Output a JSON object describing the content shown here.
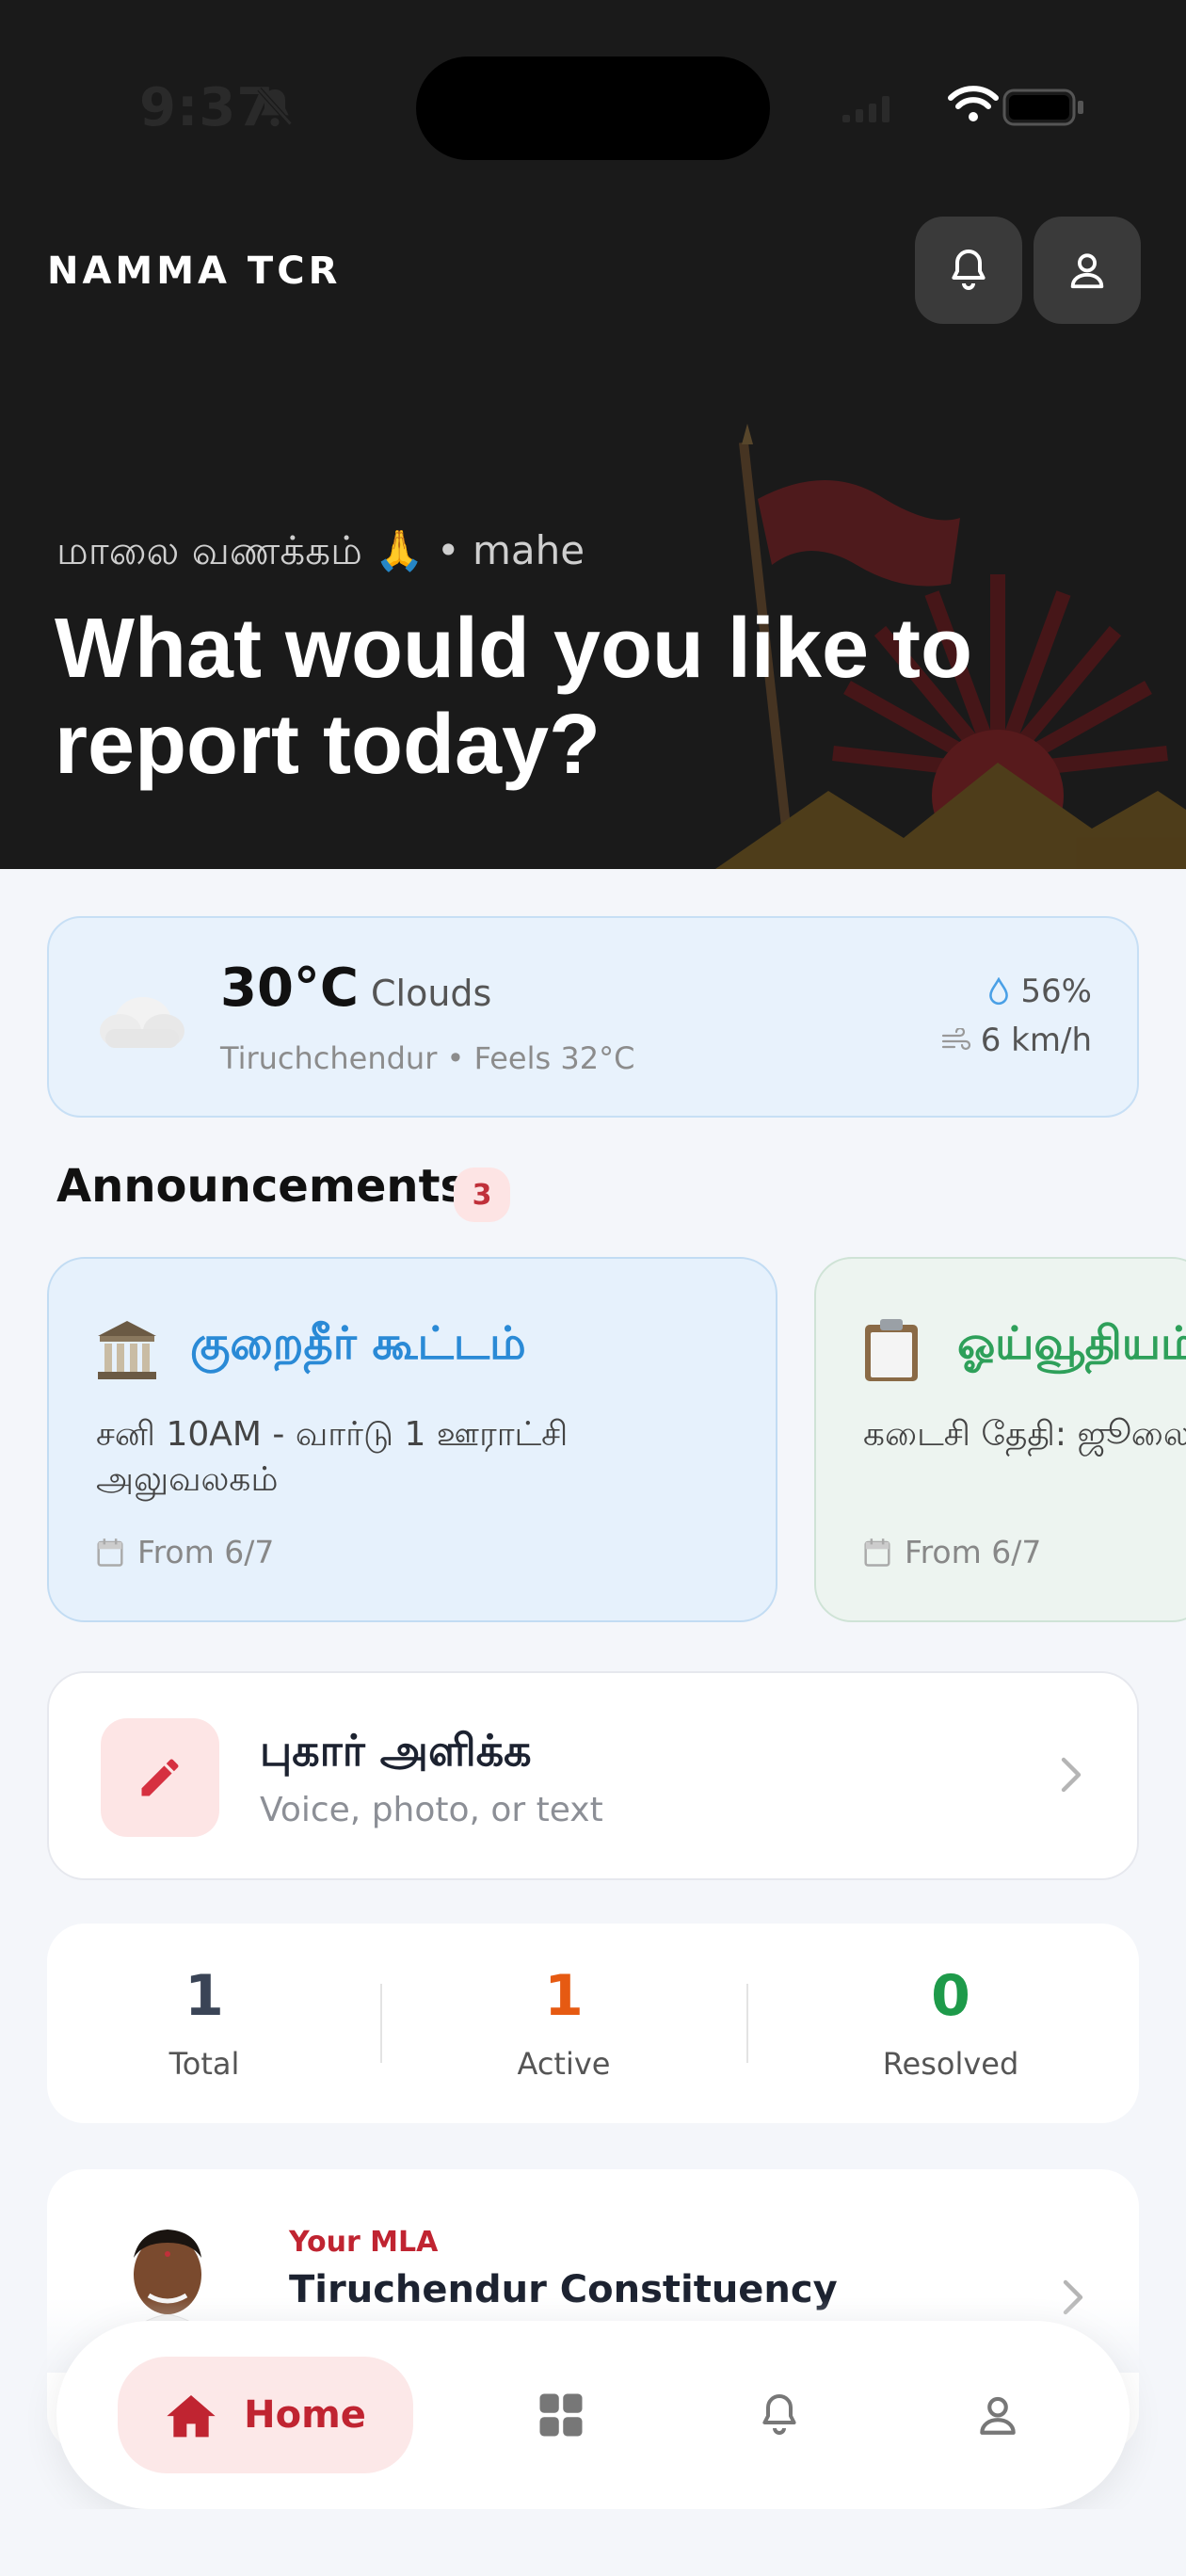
{
  "status_bar": {
    "time": "9:37"
  },
  "header": {
    "brand": "NAMMA TCR",
    "greeting": "மாலை வணக்கம் 🙏 • mahe",
    "headline": "What would you like to report today?"
  },
  "weather": {
    "temp": "30°C",
    "condition": "Clouds",
    "location": "Tiruchchendur • Feels 32°C",
    "humidity": "56%",
    "wind": "6 km/h"
  },
  "announcements": {
    "title": "Announcements",
    "count": "3",
    "items": [
      {
        "icon": "🏛️",
        "title": "குறைதீர் கூட்டம்",
        "body": "சனி 10AM - வார்டு 1 ஊராட்சி அலுவலகம்",
        "date": "From 6/7"
      },
      {
        "icon": "📋",
        "title": "ஓய்வூதியம்",
        "body": "கடைசி தேதி: ஜூலை",
        "date": "From 6/7"
      }
    ]
  },
  "submit": {
    "title": "புகார் அளிக்க",
    "subtitle": "Voice, photo, or text"
  },
  "stats": {
    "total": {
      "value": "1",
      "label": "Total"
    },
    "active": {
      "value": "1",
      "label": "Active"
    },
    "resolved": {
      "value": "0",
      "label": "Resolved"
    }
  },
  "mla": {
    "label": "Your MLA",
    "constituency": "Tiruchendur Constituency"
  },
  "nav": {
    "home": "Home"
  },
  "colors": {
    "accent": "#c02431",
    "active": "#e65a12",
    "resolved": "#1e9a4a",
    "info": "#2a8ad6"
  }
}
